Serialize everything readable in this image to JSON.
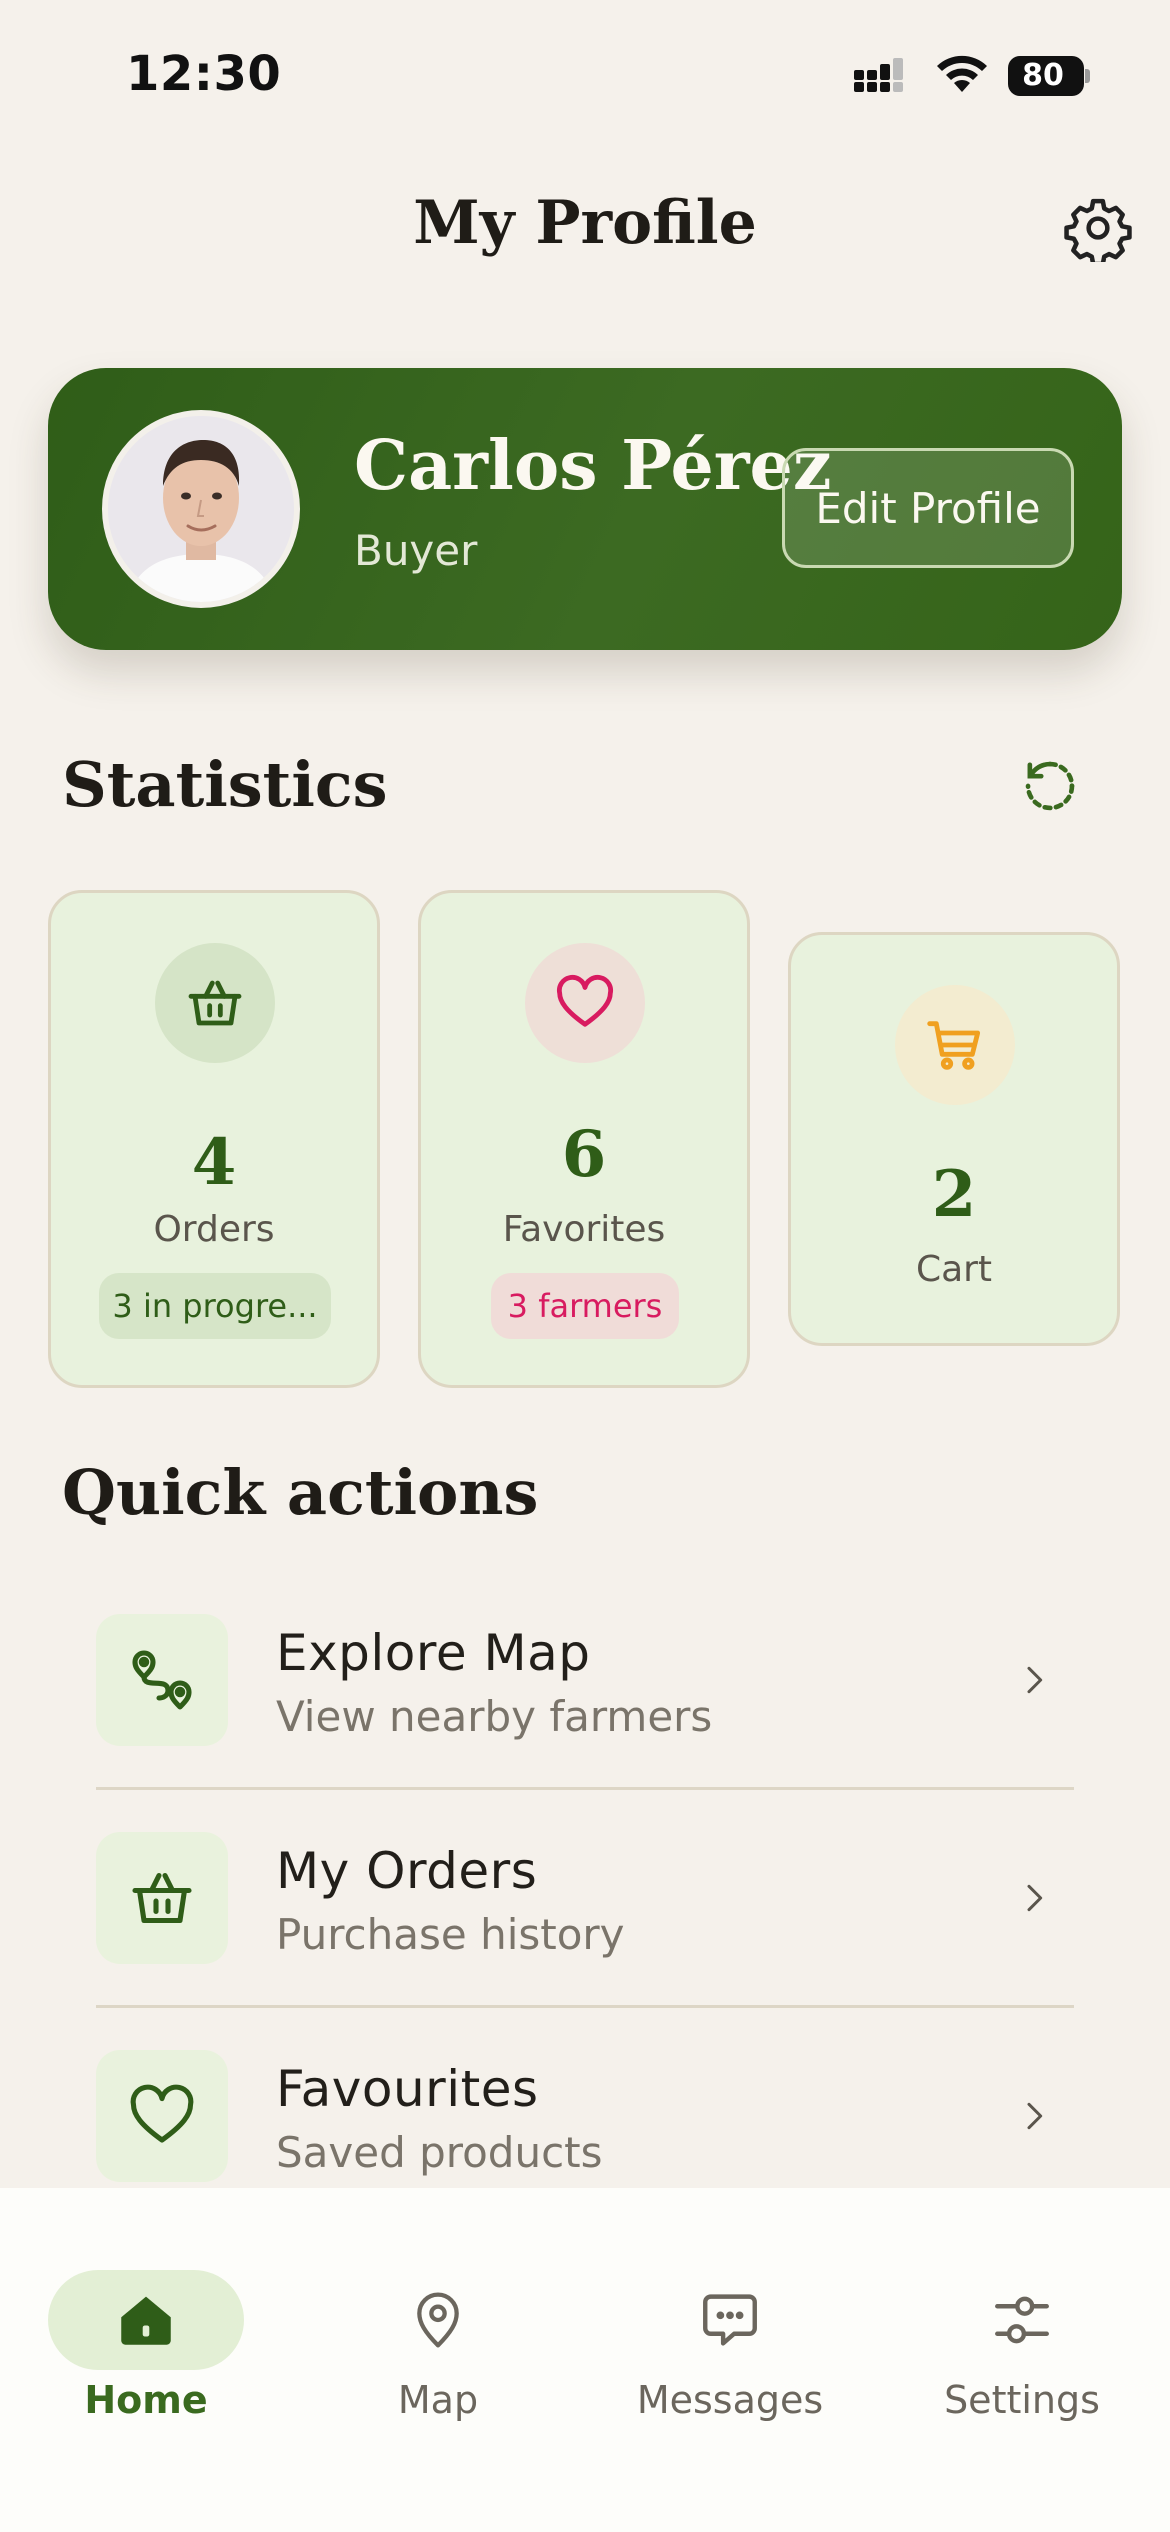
{
  "status_bar": {
    "time": "12:30",
    "battery": "80"
  },
  "header": {
    "title": "My Profile",
    "settings_icon": "gear-icon"
  },
  "profile": {
    "name": "Carlos Pérez",
    "role": "Buyer",
    "edit_label": "Edit Profile"
  },
  "statistics": {
    "title": "Statistics",
    "refresh_icon": "refresh-icon",
    "cards": [
      {
        "icon": "basket-icon",
        "value": "4",
        "label": "Orders",
        "badge": "3 in progre..."
      },
      {
        "icon": "heart-icon",
        "value": "6",
        "label": "Favorites",
        "badge": "3 farmers"
      },
      {
        "icon": "cart-icon",
        "value": "2",
        "label": "Cart"
      }
    ]
  },
  "quick_actions": {
    "title": "Quick actions",
    "items": [
      {
        "icon": "route-icon",
        "title": "Explore Map",
        "subtitle": "View nearby farmers"
      },
      {
        "icon": "basket-icon",
        "title": "My Orders",
        "subtitle": "Purchase history"
      },
      {
        "icon": "heart-icon",
        "title": "Favourites",
        "subtitle": "Saved products"
      }
    ]
  },
  "bottom_nav": {
    "items": [
      {
        "icon": "home-icon",
        "label": "Home",
        "active": true
      },
      {
        "icon": "map-pin-icon",
        "label": "Map"
      },
      {
        "icon": "chat-icon",
        "label": "Messages"
      },
      {
        "icon": "sliders-icon",
        "label": "Settings"
      }
    ]
  },
  "colors": {
    "background": "#f5f1eb",
    "primary_green": "#2f5d18",
    "card_green": "#e8f2dd",
    "heart_pink": "#d81b60",
    "cart_orange": "#f0a020"
  }
}
